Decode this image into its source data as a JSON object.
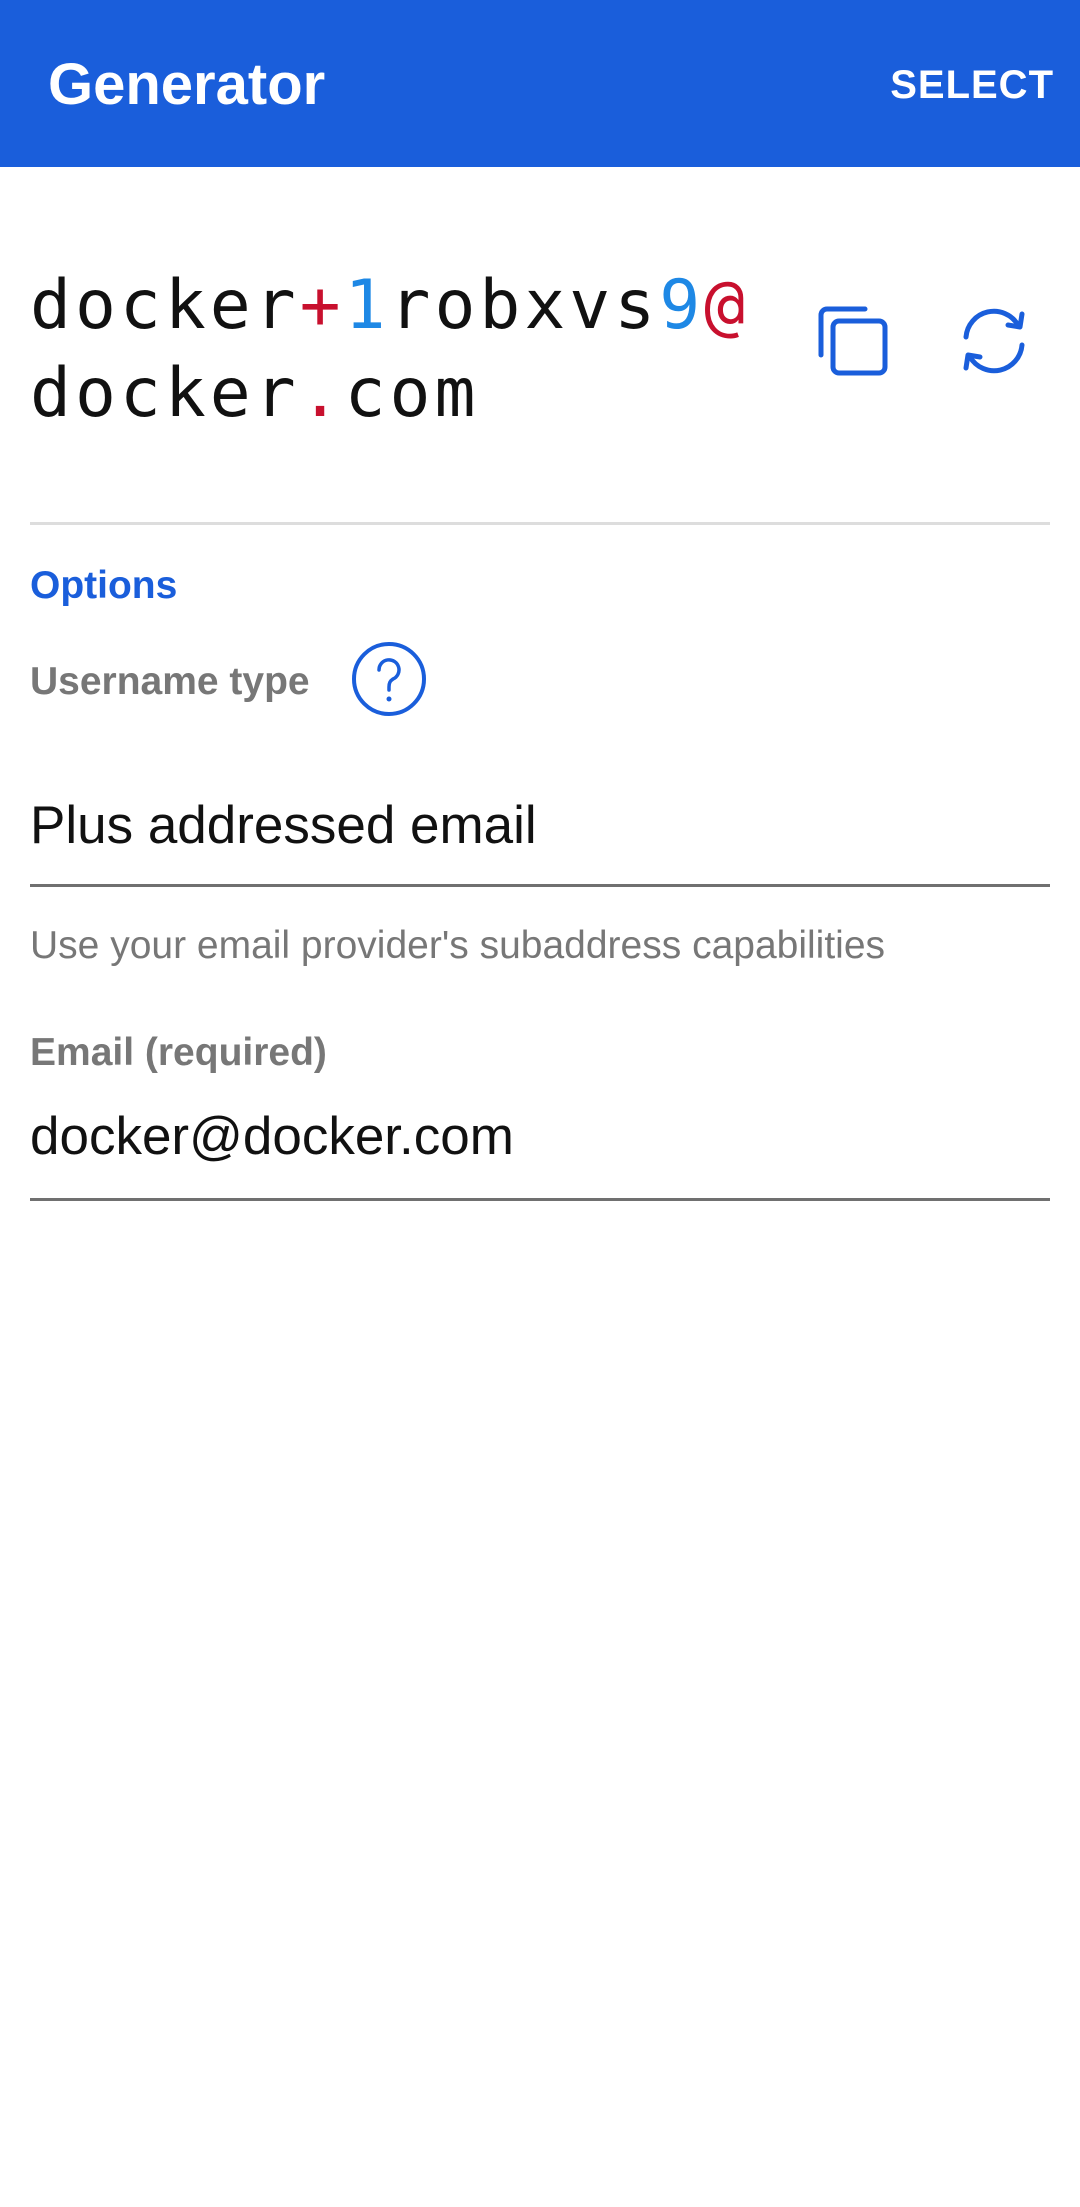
{
  "appbar": {
    "title": "Generator",
    "action_label": "SELECT"
  },
  "generated": {
    "segments": [
      {
        "text": "docker",
        "kind": "letters"
      },
      {
        "text": "+",
        "kind": "special"
      },
      {
        "text": "1",
        "kind": "number"
      },
      {
        "text": "robxvs",
        "kind": "letters"
      },
      {
        "text": "9",
        "kind": "number"
      },
      {
        "text": "@",
        "kind": "special"
      },
      {
        "text": "docker",
        "kind": "letters"
      },
      {
        "text": ".",
        "kind": "special"
      },
      {
        "text": "com",
        "kind": "letters"
      }
    ]
  },
  "icons": {
    "copy": "copy-icon",
    "regenerate": "refresh-icon",
    "help": "help-circle-icon"
  },
  "options": {
    "section_title": "Options",
    "username_type_label": "Username type",
    "username_type_value": "Plus addressed email",
    "username_type_helper": "Use your email provider's subaddress capabilities",
    "email_label": "Email (required)",
    "email_value": "docker@docker.com"
  },
  "colors": {
    "primary": "#1a5edb",
    "special_char": "#c8102e",
    "number_char": "#1e88e5",
    "muted_text": "#777777"
  }
}
